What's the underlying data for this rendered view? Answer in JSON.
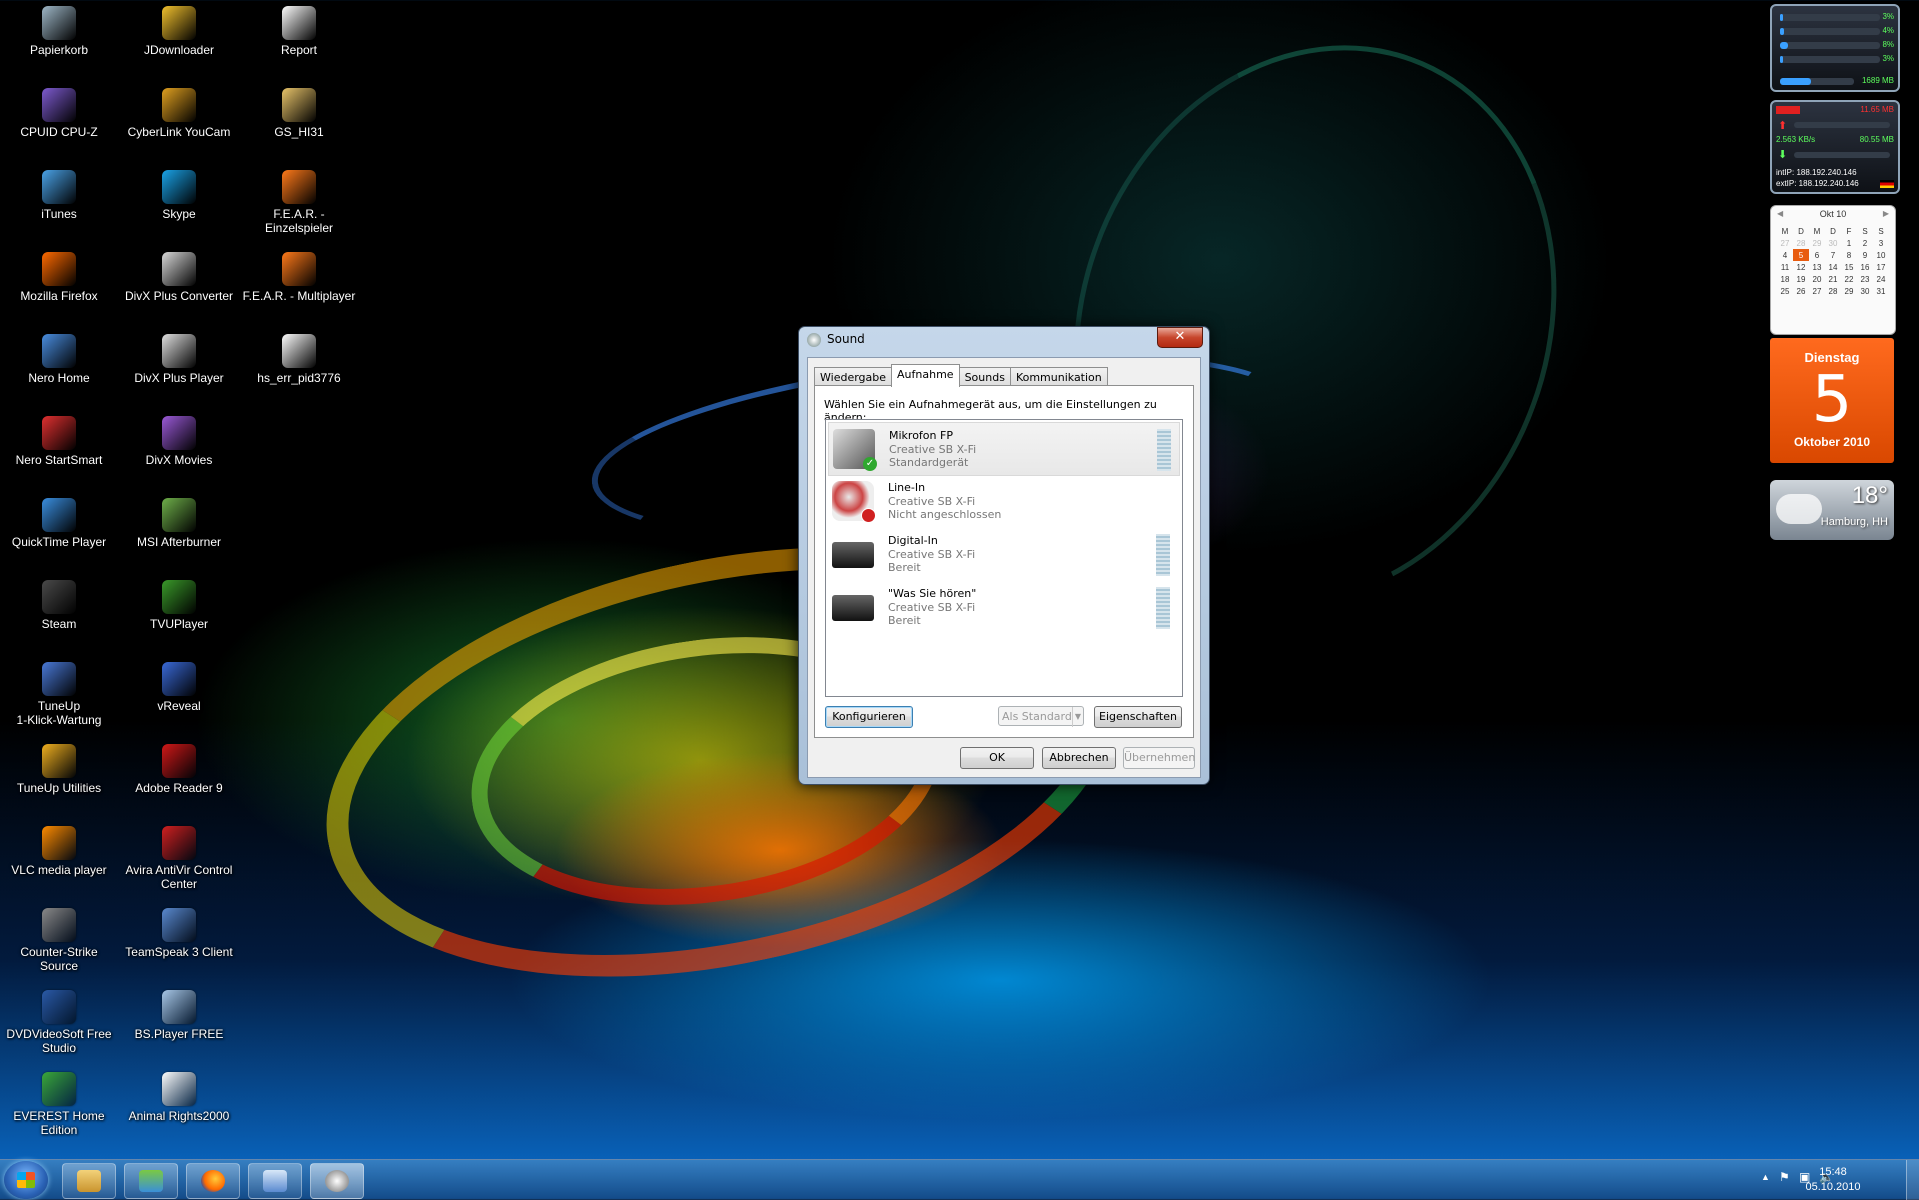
{
  "desktop": {
    "icons": [
      {
        "label": "Papierkorb",
        "icon": "recycle-bin-icon",
        "color": "#9fb8c8"
      },
      {
        "label": "JDownloader",
        "icon": "jdownloader-icon",
        "color": "#f2c12e"
      },
      {
        "label": "Report",
        "icon": "firefox-report-icon",
        "color": "#ffffff"
      },
      {
        "label": "CPUID CPU-Z",
        "icon": "cpuz-icon",
        "color": "#7e5bd0"
      },
      {
        "label": "CyberLink YouCam",
        "icon": "youcam-icon",
        "color": "#e0a020"
      },
      {
        "label": "GS_HI31",
        "icon": "folder-icon",
        "color": "#e8c46a"
      },
      {
        "label": "iTunes",
        "icon": "itunes-icon",
        "color": "#4aa3e8"
      },
      {
        "label": "Skype",
        "icon": "skype-icon",
        "color": "#1aa3e8"
      },
      {
        "label": "F.E.A.R. - Einzelspieler",
        "icon": "fear-icon",
        "color": "#ff7a1a"
      },
      {
        "label": "Mozilla Firefox",
        "icon": "firefox-icon",
        "color": "#ff6a00"
      },
      {
        "label": "DivX Plus Converter",
        "icon": "divx-converter-icon",
        "color": "#d9d9d9"
      },
      {
        "label": "F.E.A.R. - Multiplayer",
        "icon": "fear-icon",
        "color": "#ff7a1a"
      },
      {
        "label": "Nero Home",
        "icon": "nero-home-icon",
        "color": "#4a8ee0"
      },
      {
        "label": "DivX Plus Player",
        "icon": "divx-player-icon",
        "color": "#e0e0e0"
      },
      {
        "label": "hs_err_pid3776",
        "icon": "text-file-icon",
        "color": "#ffffff"
      },
      {
        "label": "Nero StartSmart",
        "icon": "nero-startsmart-icon",
        "color": "#e03030"
      },
      {
        "label": "DivX Movies",
        "icon": "divx-movies-icon",
        "color": "#9b5ad8"
      },
      {
        "label": "QuickTime Player",
        "icon": "quicktime-icon",
        "color": "#3a8fe0"
      },
      {
        "label": "MSI Afterburner",
        "icon": "afterburner-icon",
        "color": "#6fb04a"
      },
      {
        "label": "Steam",
        "icon": "steam-icon",
        "color": "#4a4a4a"
      },
      {
        "label": "TVUPlayer",
        "icon": "tvu-icon",
        "color": "#3a9a2a"
      },
      {
        "label": "TuneUp\n1-Klick-Wartung",
        "icon": "tuneup-icon",
        "color": "#4a7ad8"
      },
      {
        "label": "vReveal",
        "icon": "vreveal-icon",
        "color": "#3a6ad8"
      },
      {
        "label": "TuneUp Utilities",
        "icon": "tuneup-utilities-icon",
        "color": "#f0b020"
      },
      {
        "label": "Adobe Reader 9",
        "icon": "adobe-reader-icon",
        "color": "#d01818"
      },
      {
        "label": "VLC media player",
        "icon": "vlc-icon",
        "color": "#ff8c00"
      },
      {
        "label": "Avira AntiVir Control Center",
        "icon": "avira-icon",
        "color": "#d02020"
      },
      {
        "label": "Counter-Strike Source",
        "icon": "counter-strike-icon",
        "color": "#8a8a8a"
      },
      {
        "label": "TeamSpeak 3 Client",
        "icon": "teamspeak-icon",
        "color": "#5a8ad0"
      },
      {
        "label": "DVDVideoSoft Free Studio",
        "icon": "dvdvideosoft-icon",
        "color": "#2a5aa8"
      },
      {
        "label": "BS.Player FREE",
        "icon": "bsplayer-icon",
        "color": "#a8c8e8"
      },
      {
        "label": "EVEREST Home Edition",
        "icon": "everest-icon",
        "color": "#3aa83a"
      },
      {
        "label": "Animal Rights2000",
        "icon": "mp3-file-icon",
        "color": "#ffffff"
      }
    ]
  },
  "gadgets": {
    "cpu_meter": {
      "rows": [
        {
          "pct": "3%",
          "value": 0.03
        },
        {
          "pct": "4%",
          "value": 0.04
        },
        {
          "pct": "8%",
          "value": 0.08
        },
        {
          "pct": "3%",
          "value": 0.03
        }
      ],
      "memory": "1689 MB",
      "memory_value": 0.42
    },
    "network_meter": {
      "up_total": "11.65 MB",
      "down_rate": "2.563 KB/s",
      "down_total": "80.55 MB",
      "int_ip": "intIP: 188.192.240.146",
      "ext_ip": "extIP: 188.192.240.146"
    },
    "calendar": {
      "month": "Okt 10",
      "weekdays": [
        "M",
        "D",
        "M",
        "D",
        "F",
        "S",
        "S"
      ],
      "weeks": [
        [
          "27",
          "28",
          "29",
          "30",
          "1",
          "2",
          "3"
        ],
        [
          "4",
          "5",
          "6",
          "7",
          "8",
          "9",
          "10"
        ],
        [
          "11",
          "12",
          "13",
          "14",
          "15",
          "16",
          "17"
        ],
        [
          "18",
          "19",
          "20",
          "21",
          "22",
          "23",
          "24"
        ],
        [
          "25",
          "26",
          "27",
          "28",
          "29",
          "30",
          "31"
        ]
      ],
      "today": "5"
    },
    "date": {
      "weekday": "Dienstag",
      "day": "5",
      "month_year": "Oktober 2010"
    },
    "weather": {
      "temp": "18°",
      "city": "Hamburg, HH"
    }
  },
  "dialog": {
    "title": "Sound",
    "close_label": "✕",
    "tabs": [
      "Wiedergabe",
      "Aufnahme",
      "Sounds",
      "Kommunikation"
    ],
    "active_tab": "Aufnahme",
    "instruction": "Wählen Sie ein Aufnahmegerät aus, um die Einstellungen zu ändern:",
    "devices": [
      {
        "name": "Mikrofon FP",
        "card": "Creative SB X-Fi",
        "status": "Standardgerät",
        "icon": "microphone-icon",
        "badge": "check-badge-icon",
        "selected": true
      },
      {
        "name": "Line-In",
        "card": "Creative SB X-Fi",
        "status": "Nicht angeschlossen",
        "icon": "cable-icon",
        "badge": "disconnected-badge-icon",
        "selected": false
      },
      {
        "name": "Digital-In",
        "card": "Creative SB X-Fi",
        "status": "Bereit",
        "icon": "soundcard-icon",
        "badge": "",
        "selected": false
      },
      {
        "name": "\"Was Sie hören\"",
        "card": "Creative SB X-Fi",
        "status": "Bereit",
        "icon": "soundcard-icon",
        "badge": "",
        "selected": false
      }
    ],
    "buttons": {
      "configure": "Konfigurieren",
      "set_default": "Als Standard",
      "properties": "Eigenschaften",
      "ok": "OK",
      "cancel": "Abbrechen",
      "apply": "Übernehmen"
    }
  },
  "taskbar": {
    "apps": [
      "explorer-icon",
      "network-icon",
      "firefox-icon",
      "control-panel-icon",
      "sound-icon"
    ],
    "time": "15:48",
    "date": "05.10.2010"
  }
}
